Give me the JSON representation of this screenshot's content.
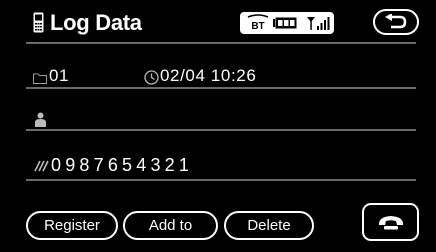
{
  "header": {
    "title": "Log Data",
    "icon": "phone-handset-icon"
  },
  "status": {
    "bluetooth_label": "BT",
    "battery_icon": "battery-icon",
    "signal_icon": "signal-strength-icon"
  },
  "back_button": {
    "icon": "return-arrow-icon"
  },
  "entry": {
    "folder_number": "01",
    "datetime": "02/04 10:26",
    "name": "",
    "phone_number": "0987654321"
  },
  "buttons": {
    "register_label": "Register",
    "add_to_label": "Add to",
    "delete_label": "Delete"
  },
  "call_button": {
    "icon": "call-handset-icon"
  },
  "colors": {
    "background": "#000000",
    "foreground": "#ffffff",
    "separator": "#6a6a6a"
  }
}
